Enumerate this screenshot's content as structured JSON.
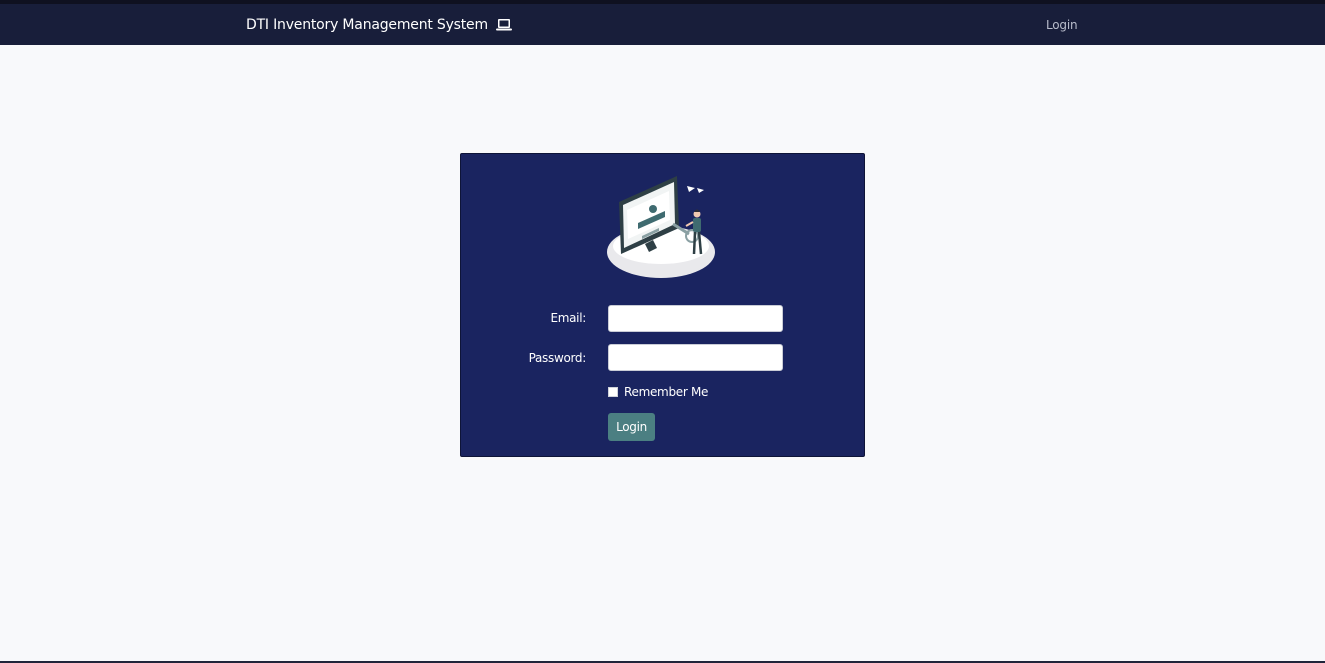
{
  "navbar": {
    "brand": "DTI Inventory Management System",
    "brand_icon": "laptop-icon",
    "login_link": "Login"
  },
  "login_form": {
    "illustration": "login-illustration",
    "email_label": "Email:",
    "email_value": "",
    "password_label": "Password:",
    "password_value": "",
    "remember_label": "Remember Me",
    "remember_checked": false,
    "submit_label": "Login"
  },
  "colors": {
    "navbar_bg": "#181e3a",
    "card_bg": "#1a2460",
    "button_bg": "#4b7f82",
    "page_bg": "#f8f9fb"
  }
}
